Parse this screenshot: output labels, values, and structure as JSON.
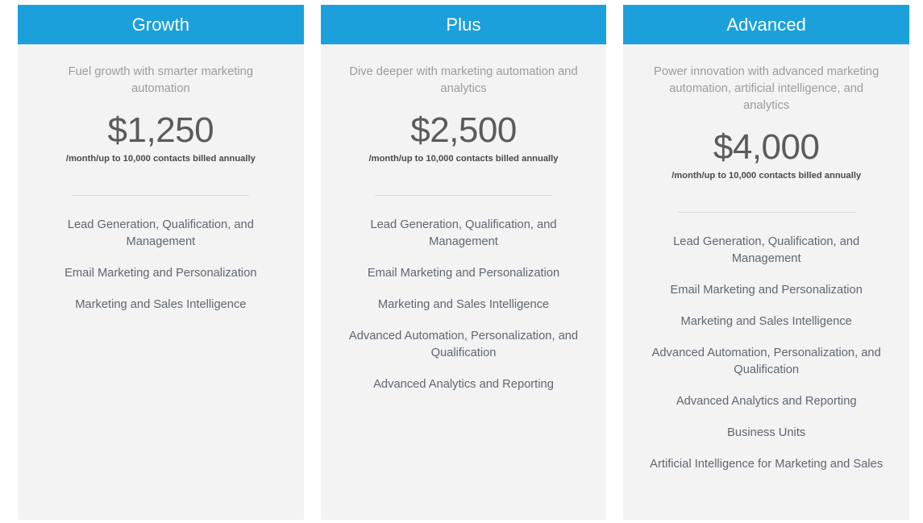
{
  "theme": {
    "header_bg": "#1ba0dc",
    "header_text": "#ffffff",
    "card_bg": "#f3f3f3",
    "page_bg": "#ffffff",
    "desc_text": "#9c9c9c",
    "price_text": "#5b5b5b",
    "note_text": "#4a4a4a",
    "feature_text": "#5f6672",
    "divider": "#dcdcdc"
  },
  "plans": [
    {
      "name": "Growth",
      "description": "Fuel growth with smarter marketing automation",
      "price": "$1,250",
      "price_note": "/month/up to 10,000 contacts billed annually",
      "features": [
        "Lead Generation, Qualification, and Management",
        "Email Marketing and Personalization",
        "Marketing and Sales Intelligence"
      ]
    },
    {
      "name": "Plus",
      "description": "Dive deeper with marketing automation and analytics",
      "price": "$2,500",
      "price_note": "/month/up to 10,000 contacts billed annually",
      "features": [
        "Lead Generation, Qualification, and Management",
        "Email Marketing and Personalization",
        "Marketing and Sales Intelligence",
        "Advanced Automation, Personalization, and Qualification",
        "Advanced Analytics and Reporting"
      ]
    },
    {
      "name": "Advanced",
      "description": "Power innovation with advanced marketing automation, artificial intelligence, and analytics",
      "price": "$4,000",
      "price_note": "/month/up to 10,000 contacts billed annually",
      "features": [
        "Lead Generation, Qualification, and Management",
        "Email Marketing and Personalization",
        "Marketing and Sales Intelligence",
        "Advanced Automation, Personalization, and Qualification",
        "Advanced Analytics and Reporting",
        "Business Units",
        "Artificial Intelligence for Marketing and Sales"
      ]
    }
  ]
}
